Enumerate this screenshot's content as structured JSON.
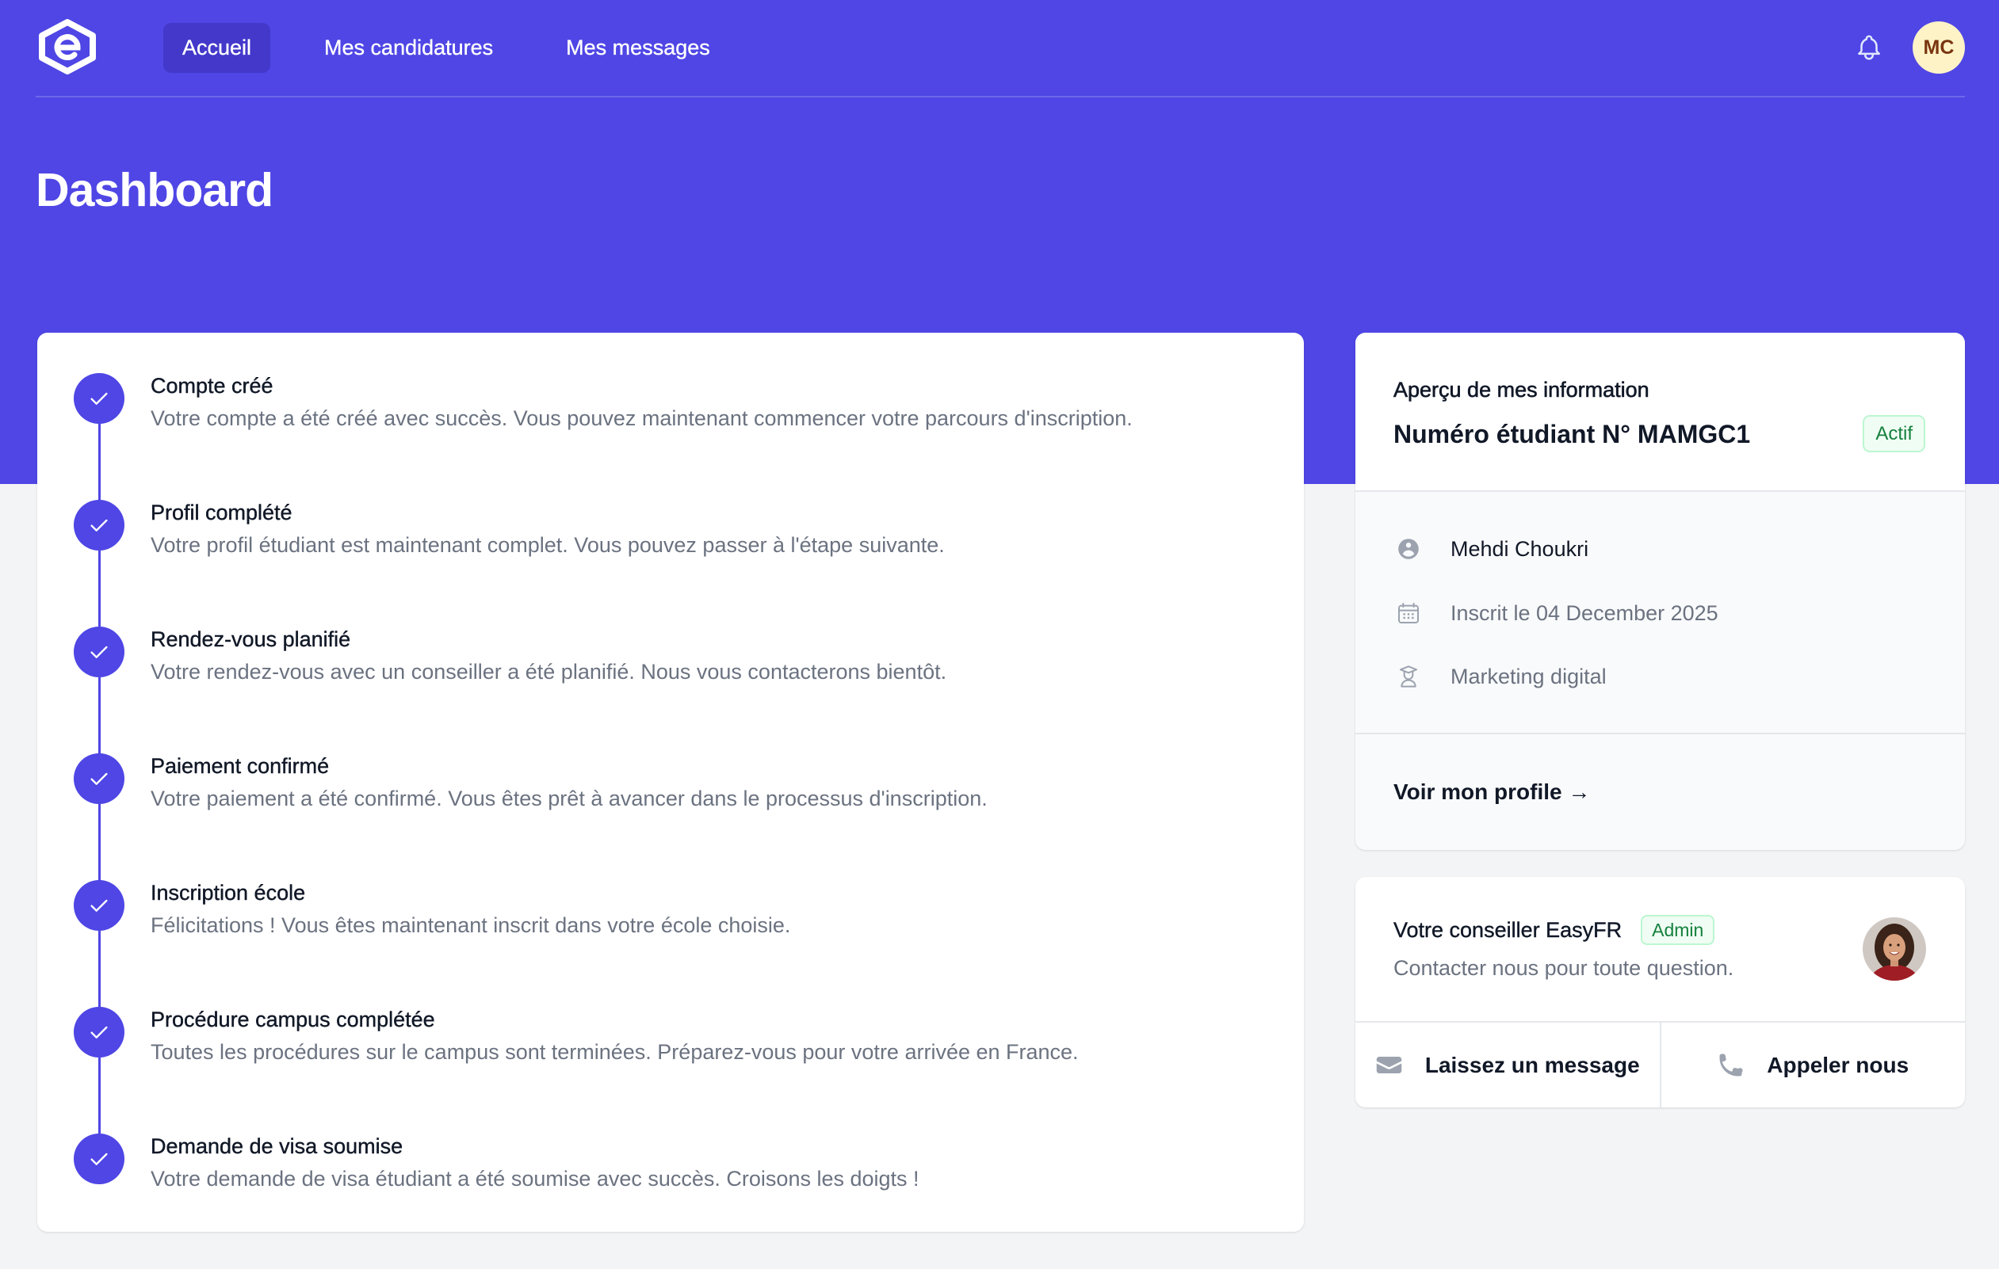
{
  "colors": {
    "primary": "#4F46E5",
    "primary_dark": "#4338CA",
    "page_bg": "#F3F4F6",
    "success": "#15803D",
    "avatar_bg": "#FEF3C7",
    "avatar_text": "#78350F"
  },
  "brand": {
    "logo_icon": "easyfr-logo-icon"
  },
  "nav": {
    "items": [
      {
        "label": "Accueil",
        "active": true
      },
      {
        "label": "Mes candidatures",
        "active": false
      },
      {
        "label": "Mes messages",
        "active": false
      }
    ]
  },
  "header": {
    "notification_icon": "bell-icon",
    "user_initials": "MC"
  },
  "page": {
    "title": "Dashboard"
  },
  "timeline": {
    "steps": [
      {
        "status": "completed",
        "icon": "check-icon",
        "title": "Compte créé",
        "description": "Votre compte a été créé avec succès. Vous pouvez maintenant commencer votre parcours d'inscription."
      },
      {
        "status": "completed",
        "icon": "check-icon",
        "title": "Profil complété",
        "description": "Votre profil étudiant est maintenant complet. Vous pouvez passer à l'étape suivante."
      },
      {
        "status": "completed",
        "icon": "check-icon",
        "title": "Rendez-vous planifié",
        "description": "Votre rendez-vous avec un conseiller a été planifié. Nous vous contacterons bientôt."
      },
      {
        "status": "completed",
        "icon": "check-icon",
        "title": "Paiement confirmé",
        "description": "Votre paiement a été confirmé. Vous êtes prêt à avancer dans le processus d'inscription."
      },
      {
        "status": "completed",
        "icon": "check-icon",
        "title": "Inscription école",
        "description": "Félicitations ! Vous êtes maintenant inscrit dans votre école choisie."
      },
      {
        "status": "completed",
        "icon": "check-icon",
        "title": "Procédure campus complétée",
        "description": "Toutes les procédures sur le campus sont terminées. Préparez-vous pour votre arrivée en France."
      },
      {
        "status": "completed",
        "icon": "check-icon",
        "title": "Demande de visa soumise",
        "description": "Votre demande de visa étudiant a été soumise avec succès. Croisons les doigts !"
      }
    ]
  },
  "info_card": {
    "heading": "Aperçu de mes information",
    "student_number": "Numéro étudiant N° MAMGC1",
    "status_badge": "Actif",
    "rows": [
      {
        "icon": "user-circle-icon",
        "text": "Mehdi Choukri"
      },
      {
        "icon": "calendar-icon",
        "text": "Inscrit le 04 December 2025"
      },
      {
        "icon": "graduate-icon",
        "text": "Marketing digital"
      }
    ],
    "profile_link": "Voir mon profile →"
  },
  "advisor_card": {
    "title": "Votre conseiller EasyFR",
    "role_badge": "Admin",
    "subtitle": "Contacter nous pour toute question.",
    "actions": [
      {
        "icon": "envelope-icon",
        "label": "Laissez un message"
      },
      {
        "icon": "phone-icon",
        "label": "Appeler nous"
      }
    ]
  }
}
